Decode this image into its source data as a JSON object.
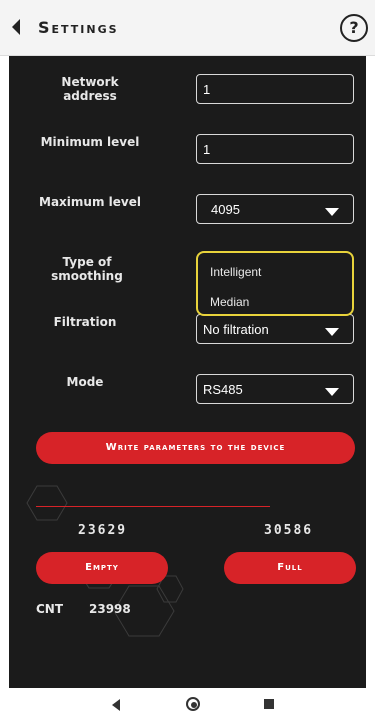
{
  "header": {
    "title": "Settings",
    "help": "?"
  },
  "form": {
    "network_address": {
      "label": "Network address",
      "value": "1"
    },
    "minimum_level": {
      "label": "Minimum level",
      "value": "1"
    },
    "maximum_level": {
      "label": "Maximum level",
      "value": "4095"
    },
    "type_of_smoothing": {
      "label": "Type of smoothing",
      "options": [
        "Intelligent",
        "Median"
      ]
    },
    "filtration": {
      "label": "Filtration",
      "value": "No filtration"
    },
    "mode": {
      "label": "Mode",
      "value": "RS485"
    }
  },
  "actions": {
    "write": "Write parameters to the device",
    "empty": "Empty",
    "full": "Full"
  },
  "calibration": {
    "empty_value": "23629",
    "full_value": "30586",
    "cnt_label": "CNT",
    "cnt_value": "23998"
  },
  "colors": {
    "accent": "#d72328",
    "panel_bg": "#1b1b1b",
    "popup_border": "#e8d33b"
  },
  "icons": [
    "back-icon",
    "help-icon",
    "chevron-down-icon",
    "nav-back-icon",
    "nav-home-icon",
    "nav-recents-icon"
  ]
}
